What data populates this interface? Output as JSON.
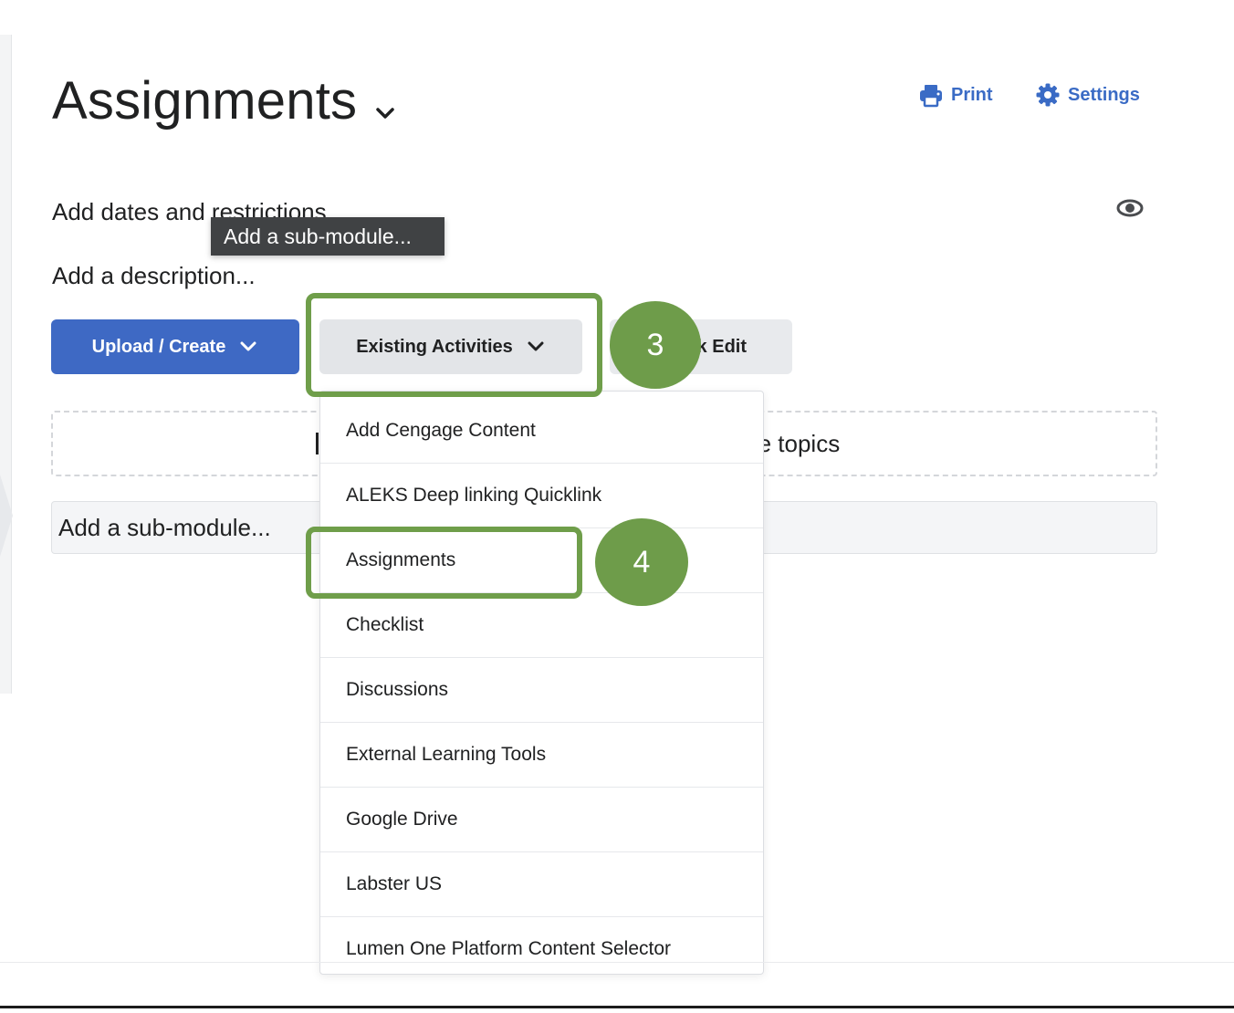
{
  "header": {
    "title": "Assignments",
    "print_label": "Print",
    "settings_label": "Settings"
  },
  "module": {
    "dates_link": "Add dates and restrictions...",
    "description_link": "Add a description...",
    "tooltip": "Add a sub-module...",
    "drop_zone_text": "pdate topics",
    "submodule_placeholder": "Add a sub-module..."
  },
  "toolbar": {
    "upload_label": "Upload / Create",
    "existing_label": "Existing Activities",
    "bulk_label": "lk Edit"
  },
  "menu": {
    "items": [
      "Add Cengage Content",
      "ALEKS Deep linking Quicklink",
      "Assignments",
      "Checklist",
      "Discussions",
      "External Learning Tools",
      "Google Drive",
      "Labster US",
      "Lumen One Platform Content Selector"
    ]
  },
  "callouts": {
    "step_3": "3",
    "step_4": "4"
  },
  "icons": {
    "title_chevron": "chevron-down-icon",
    "print": "printer-icon",
    "settings": "gear-icon",
    "visibility": "eye-icon",
    "button_chevron": "chevron-down-icon"
  },
  "colors": {
    "primary": "#3e69c4",
    "link": "#3a6bc5",
    "annotation_green": "#6e9c4a",
    "tooltip_bg": "#404244"
  }
}
